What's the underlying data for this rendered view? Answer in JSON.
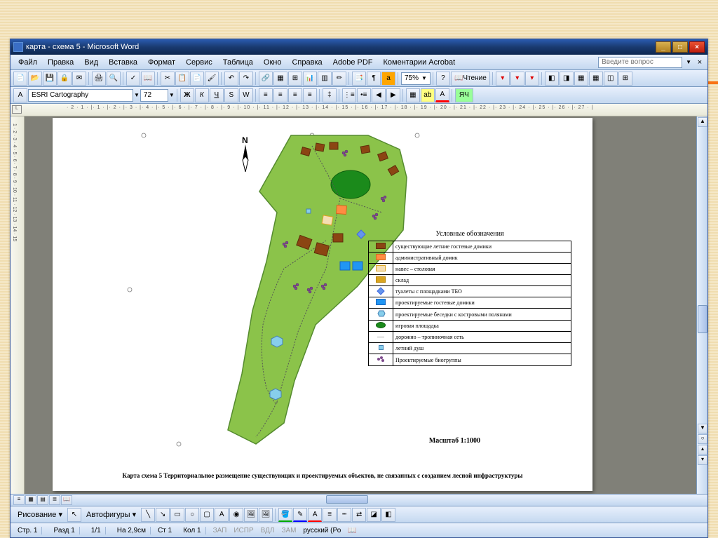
{
  "window": {
    "title": "карта - схема 5 - Microsoft Word"
  },
  "menu": {
    "items": [
      "Файл",
      "Правка",
      "Вид",
      "Вставка",
      "Формат",
      "Сервис",
      "Таблица",
      "Окно",
      "Справка",
      "Adobe PDF",
      "Коментарии Acrobat"
    ],
    "search_placeholder": "Введите вопрос"
  },
  "toolbar": {
    "zoom": "75%",
    "reading": "Чтение"
  },
  "formatbar": {
    "font": "ESRI Cartography",
    "size": "72"
  },
  "ruler": {
    "corner": "L",
    "h_marks": "· 2 · 1 · |· 1 · |· 2 · |· 3 · |· 4 · |· 5 · |· 6 · |· 7 · |· 8 · |· 9 · |· 10 · |· 11 · |· 12 · |· 13 · |· 14 · |· 15 · |· 16 · |· 17 · |· 18 · |· 19 · |· 20 · |· 21 · |· 22 · |· 23 · |· 24 · |· 25 · |· 26 · |· 27 · |",
    "v_marks": "1 · 2 · 3 · 4 · 5 · 6 · 7 · 8 · 9 · 10 · 11 · 12 · 13 · 14 · 15"
  },
  "drawing": {
    "label": "Рисование",
    "autoshapes": "Автофигуры"
  },
  "statusbar": {
    "page": "Стр. 1",
    "section": "Разд 1",
    "pages": "1/1",
    "position": "На 2,9см",
    "line": "Ст 1",
    "column": "Кол 1",
    "rec": "ЗАП",
    "trk": "ИСПР",
    "ext": "ВДЛ",
    "ovr": "ЗАМ",
    "language": "русский (Ро"
  },
  "map": {
    "compass": "N",
    "legend_title": "Условные обозначения",
    "legend_items": [
      {
        "icon": "brown-box",
        "label": "существующие летние гостевые домики"
      },
      {
        "icon": "orange-box",
        "label": "административный домик"
      },
      {
        "icon": "tan-box",
        "label": "навес – столовая"
      },
      {
        "icon": "yellow-box",
        "label": "склад"
      },
      {
        "icon": "blue-diamond",
        "label": "туалеты с площадками ТБО"
      },
      {
        "icon": "blue-box",
        "label": "проектируемые гостевые домики"
      },
      {
        "icon": "blue-hex",
        "label": "проектируемые беседки с костровыми полянами"
      },
      {
        "icon": "green-oval",
        "label": "игровая площадка"
      },
      {
        "icon": "dotted",
        "label": "дорожно – тропиночная сеть"
      },
      {
        "icon": "shower",
        "label": "летний душ"
      },
      {
        "icon": "biogroup",
        "label": "Проектируемые биогруппы"
      }
    ],
    "scale": "Масштаб 1:1000",
    "caption": "Карта схема 5 Территориальное размещение существующих и проектируемых объектов, не связанных с созданием лесной инфраструктуры"
  }
}
